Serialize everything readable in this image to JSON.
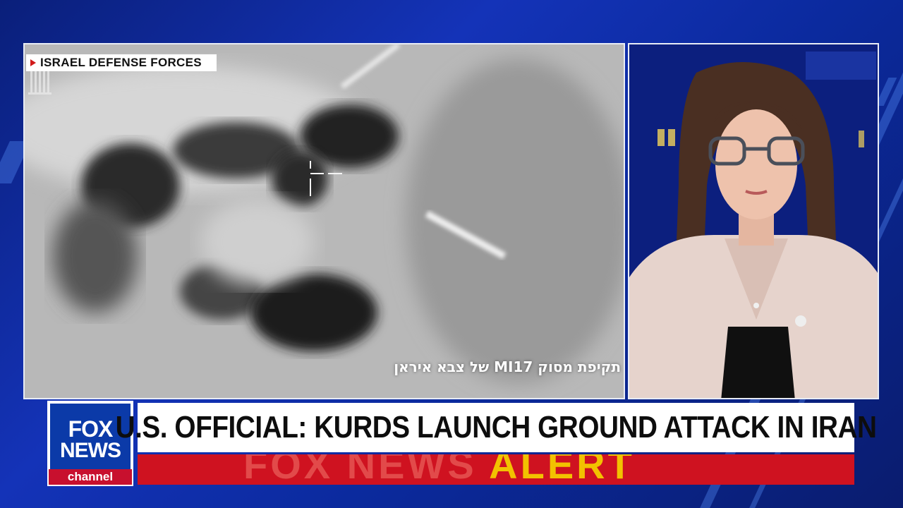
{
  "video": {
    "source_label": "ISRAEL DEFENSE FORCES",
    "caption": "תקיפת מסוק MI17 של צבא איראן"
  },
  "lower_third": {
    "logo": {
      "line1": "FOX",
      "line2": "NEWS",
      "line3": "channel"
    },
    "headline": "U.S. OFFICIAL: KURDS LAUNCH GROUND ATTACK IN IRAN",
    "alert_banner": {
      "word1": "FOX NEWS",
      "word2": "ALERT"
    }
  },
  "colors": {
    "background_blue": "#1433b8",
    "alert_red": "#cf1220",
    "alert_yellow": "#f2c200",
    "source_arrow_red": "#d11a1a"
  }
}
